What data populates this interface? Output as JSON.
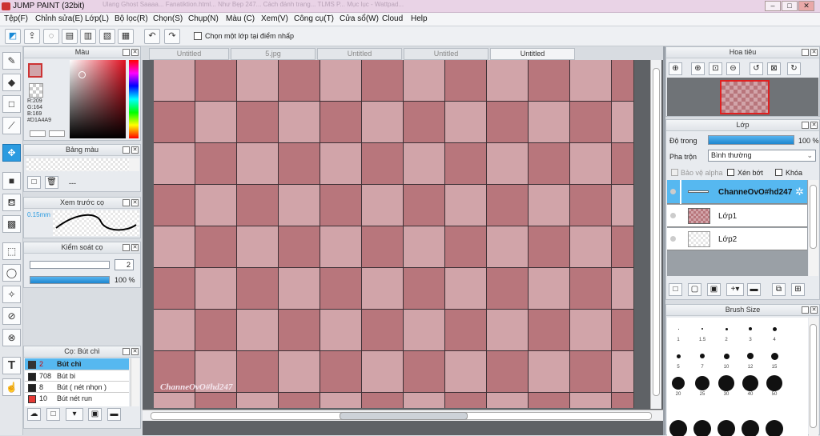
{
  "window": {
    "title": "JUMP PAINT (32bit)",
    "bg_tabs": "Ulang Ghost Saaaa...   Fanatiktion.html...   Như Bẹp 247...   Cách đánh trang...   TLMS P...   Mục lục - Wattpad..."
  },
  "menu": [
    "Tệp(F)",
    "Chỉnh sửa(E)",
    "Lớp(L)",
    "Bộ lọc(R)",
    "Chọn(S)",
    "Chụp(N)",
    "Màu (C)",
    "Xem(V)",
    "Công cụ(T)",
    "Cửa sổ(W)",
    "Cloud",
    "Help"
  ],
  "toolbar": {
    "checkbox_label": "Chọn một lớp tại điểm nhấp"
  },
  "color_panel": {
    "title": "Màu",
    "r": "R:209",
    "g": "G:164",
    "b": "B:169",
    "hex": "#D1A4A9",
    "current": "#d1a4a9"
  },
  "swatch_panel": {
    "title": "Bảng màu",
    "value": "---"
  },
  "brush_preview": {
    "title": "Xem trước cọ",
    "size": "0.15mm"
  },
  "brush_control": {
    "title": "Kiểm soát cọ",
    "size_value": "2",
    "opacity": "100 %"
  },
  "brush_list": {
    "title": "Cọ: Bút chì",
    "items": [
      {
        "size": "2",
        "name": "Bút chì",
        "color": "#333333"
      },
      {
        "size": "708",
        "name": "Bút bi",
        "color": "#222222"
      },
      {
        "size": "8",
        "name": "Bút ( nét nhọn )",
        "color": "#222222"
      },
      {
        "size": "10",
        "name": "Bút nét run",
        "color": "#e53935"
      }
    ]
  },
  "tabs": [
    "Untitled",
    "5.jpg",
    "Untitled",
    "Untitled",
    "Untitled"
  ],
  "canvas": {
    "watermark": "ChanneOvO#hd247",
    "color_a": "#d1a4a9",
    "color_b": "#b8767c",
    "cols": 12,
    "rows": 9
  },
  "navigator": {
    "title": "Hoa tiêu"
  },
  "layer_panel": {
    "title": "Lớp",
    "opacity_label": "Độ trong",
    "opacity_value": "100 %",
    "blend_label": "Pha trộn",
    "blend_value": "Bình thường",
    "protect_alpha": "Bảo vệ alpha",
    "clip": "Xén bớt",
    "lock": "Khóa",
    "layers": [
      {
        "name": "ChanneOvO#hd247"
      },
      {
        "name": "Lớp1"
      },
      {
        "name": "Lớp2"
      }
    ]
  },
  "brush_size": {
    "title": "Brush Size",
    "sizes": [
      "1",
      "1.5",
      "2",
      "3",
      "4",
      "5",
      "7",
      "10",
      "12",
      "15",
      "20",
      "25",
      "30",
      "40",
      "50"
    ]
  }
}
